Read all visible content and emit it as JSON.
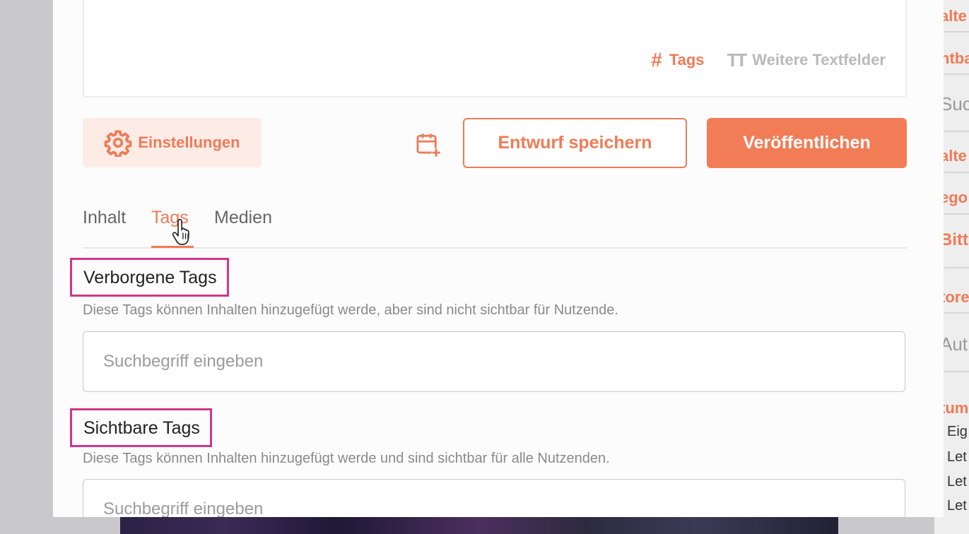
{
  "editor": {
    "tags_label": "Tags",
    "more_fields_label": "Weitere Textfelder",
    "tags_icon": "hash-icon",
    "more_fields_icon": "text-size-icon"
  },
  "toolbar": {
    "settings_label": "Einstellungen",
    "settings_icon": "gear-icon",
    "schedule_icon": "calendar-plus-icon",
    "draft_label": "Entwurf speichern",
    "publish_label": "Veröffentlichen"
  },
  "tabs": [
    {
      "label": "Inhalt",
      "active": false
    },
    {
      "label": "Tags",
      "active": true
    },
    {
      "label": "Medien",
      "active": false
    }
  ],
  "hidden_tags": {
    "title": "Verborgene Tags",
    "description": "Diese Tags können Inhalten hinzugefügt werde, aber sind nicht sichtbar für Nutzende.",
    "placeholder": "Suchbegriff eingeben"
  },
  "visible_tags": {
    "title": "Sichtbare Tags",
    "description": "Diese Tags können Inhalten hinzugefügt werde und sind sichtbar für alle Nutzenden.",
    "placeholder": "Suchbegriff eingeben"
  },
  "background_sidebar": {
    "items": [
      "alte",
      "htba",
      "Suc",
      "alte",
      "ego",
      "Bitt",
      "tore",
      "Aut",
      "tum",
      "Eig",
      "Let",
      "Let",
      "Let"
    ]
  },
  "colors": {
    "accent": "#ef7b57",
    "accent_light": "#fdece6",
    "highlight_box": "#d0368a"
  }
}
